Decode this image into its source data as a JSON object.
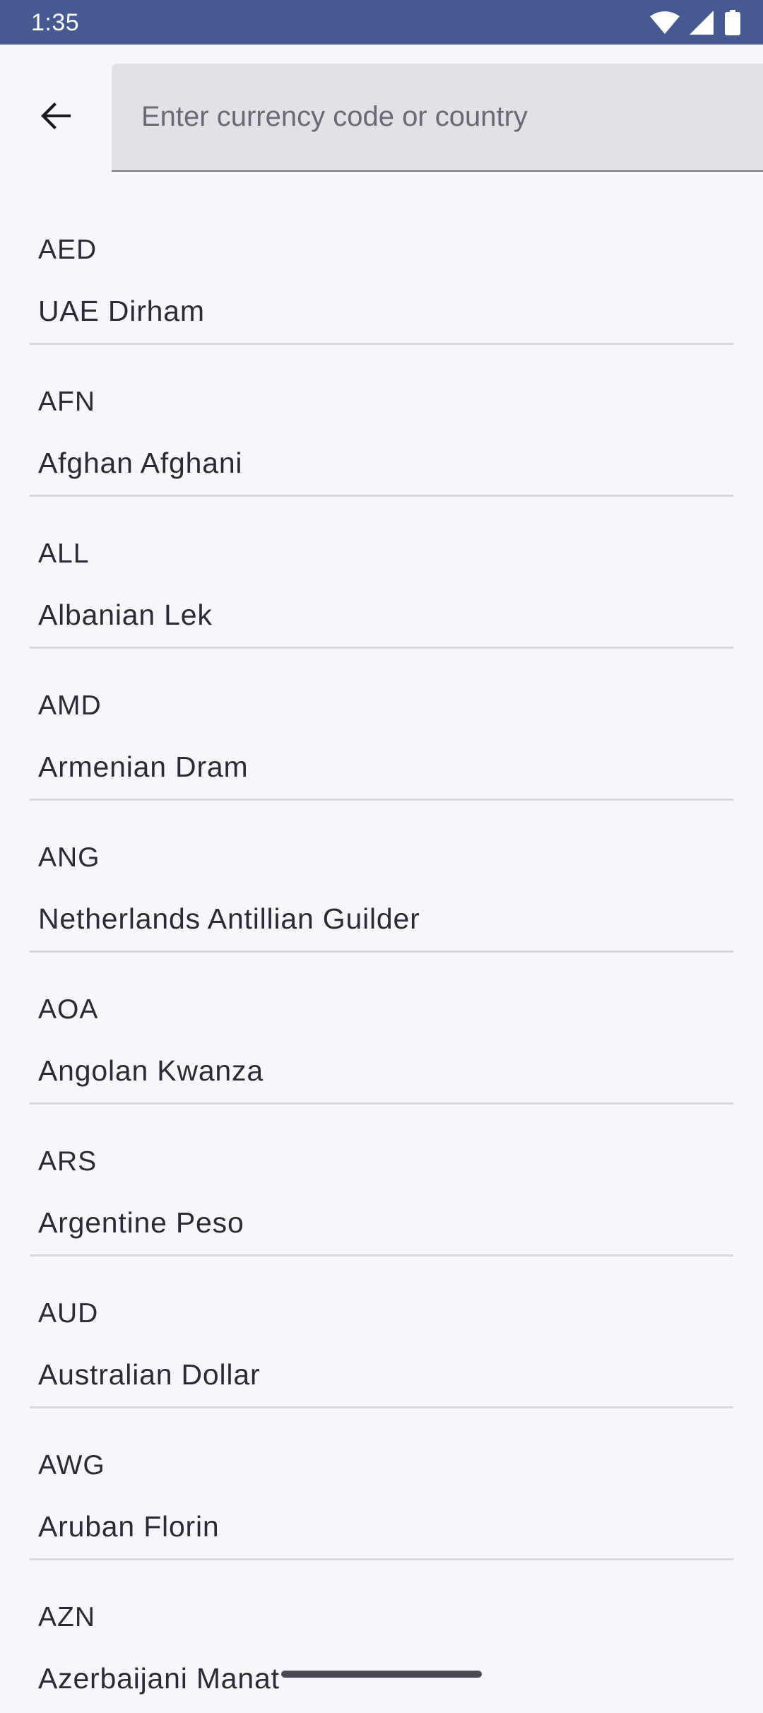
{
  "status_bar": {
    "time": "1:35",
    "icons": [
      "wifi-icon",
      "signal-icon",
      "battery-icon"
    ],
    "background": "#465a91"
  },
  "toolbar": {
    "back_icon": "arrow-back-icon",
    "search": {
      "placeholder": "Enter currency code or country",
      "value": ""
    }
  },
  "currencies": [
    {
      "code": "AED",
      "name": "UAE Dirham"
    },
    {
      "code": "AFN",
      "name": "Afghan Afghani"
    },
    {
      "code": "ALL",
      "name": "Albanian Lek"
    },
    {
      "code": "AMD",
      "name": "Armenian Dram"
    },
    {
      "code": "ANG",
      "name": "Netherlands Antillian Guilder"
    },
    {
      "code": "AOA",
      "name": "Angolan Kwanza"
    },
    {
      "code": "ARS",
      "name": "Argentine Peso"
    },
    {
      "code": "AUD",
      "name": "Australian Dollar"
    },
    {
      "code": "AWG",
      "name": "Aruban Florin"
    },
    {
      "code": "AZN",
      "name": "Azerbaijani Manat"
    }
  ]
}
